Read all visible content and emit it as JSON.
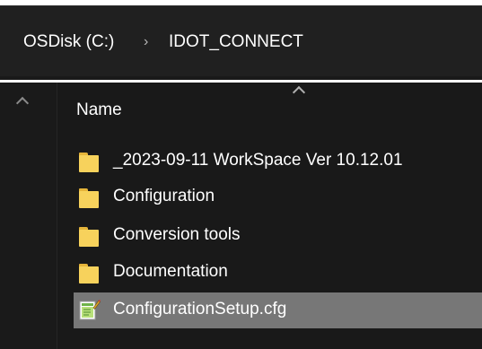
{
  "address_bar": {
    "crumbs": [
      "OSDisk (C:)",
      "IDOT_CONNECT"
    ],
    "separator": "›"
  },
  "file_list": {
    "column_header": "Name",
    "items": [
      {
        "name": "_2023-09-11 WorkSpace Ver 10.12.01",
        "type": "folder",
        "icon": "folder-icon"
      },
      {
        "name": "Configuration",
        "type": "folder",
        "icon": "folder-icon"
      },
      {
        "name": "Conversion tools",
        "type": "folder",
        "icon": "folder-icon"
      },
      {
        "name": "Documentation",
        "type": "folder",
        "icon": "folder-icon"
      },
      {
        "name": "ConfigurationSetup.cfg",
        "type": "file",
        "icon": "config-file-icon",
        "selected": true
      }
    ]
  },
  "colors": {
    "background": "#191919",
    "folder": "#f7d25c",
    "selection": "#777777"
  }
}
